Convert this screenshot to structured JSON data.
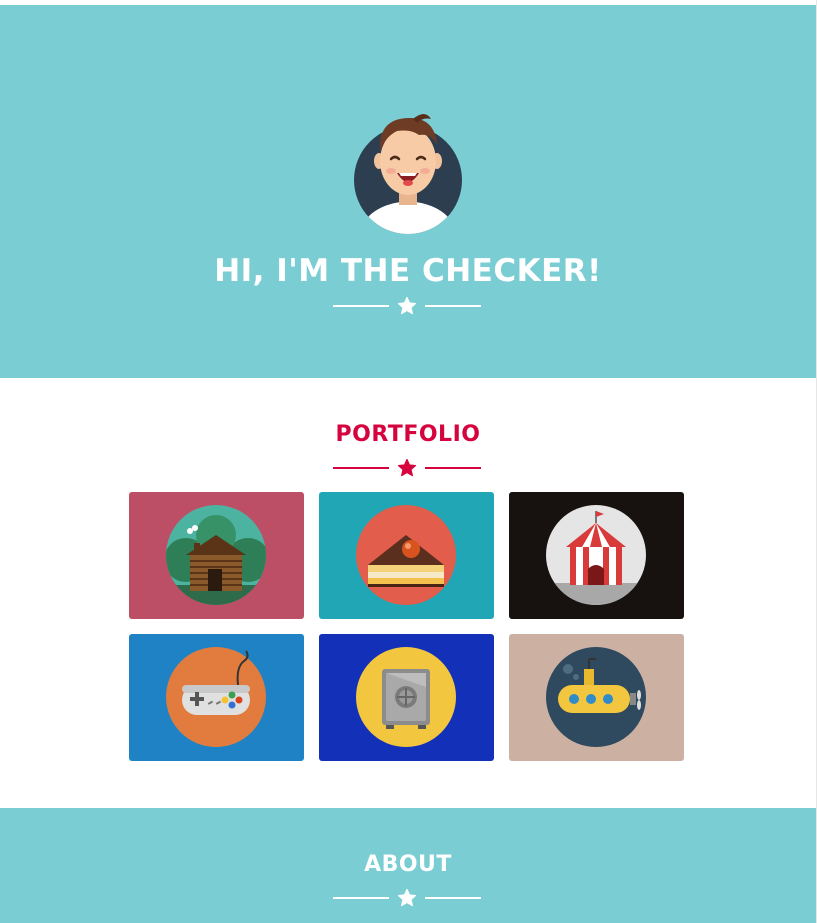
{
  "hero": {
    "title": "HI, I'M THE CHECKER!",
    "avatar_icon": "smiling-man-avatar-icon"
  },
  "portfolio": {
    "title": "PORTFOLIO",
    "items": [
      {
        "icon": "log-cabin-icon",
        "color": "#BC4F65"
      },
      {
        "icon": "cake-slice-icon",
        "color": "#20A6B5"
      },
      {
        "icon": "circus-tent-icon",
        "color": "#17110F"
      },
      {
        "icon": "game-controller-icon",
        "color": "#1E82C4"
      },
      {
        "icon": "safe-icon",
        "color": "#1330B8"
      },
      {
        "icon": "submarine-icon",
        "color": "#CCB1A3"
      }
    ]
  },
  "about": {
    "title": "ABOUT"
  },
  "colors": {
    "hero_bg": "#7ACED3",
    "accent_red": "#D6043E",
    "white": "#FFFFFF"
  }
}
